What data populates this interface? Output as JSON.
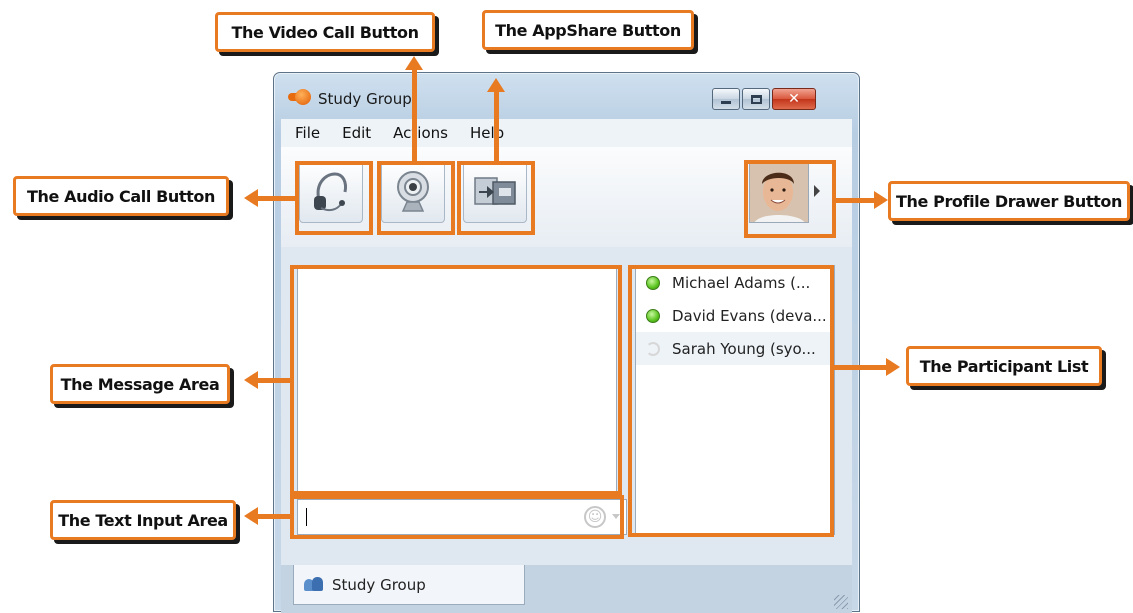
{
  "window": {
    "title": "Study Group",
    "close_symbol": "✕"
  },
  "menu": {
    "items": [
      "File",
      "Edit",
      "Actions",
      "Help"
    ]
  },
  "toolbar": {
    "buttons": [
      {
        "name": "audio-call",
        "icon": "headset-icon"
      },
      {
        "name": "video-call",
        "icon": "webcam-icon"
      },
      {
        "name": "appshare",
        "icon": "appshare-icon"
      }
    ],
    "profile_icon": "avatar"
  },
  "participants": [
    {
      "name": "Michael Adams (...",
      "status": "online"
    },
    {
      "name": "David Evans (deva...",
      "status": "online"
    },
    {
      "name": "Sarah Young (syo...",
      "status": "offline"
    }
  ],
  "input": {
    "value": "",
    "emoji_icon": "smiley-icon"
  },
  "tab": {
    "label": "Study Group"
  },
  "callouts": {
    "video_call": "The Video Call Button",
    "appshare": "The AppShare Button",
    "audio_call": "The Audio Call Button",
    "profile_drawer": "The Profile Drawer Button",
    "message_area": "The Message Area",
    "participant_list": "The Participant List",
    "text_input": "The Text Input Area"
  },
  "colors": {
    "callout_accent": "#e87a22",
    "online": "#5ac41f",
    "window_frame": "#b7cde2"
  }
}
